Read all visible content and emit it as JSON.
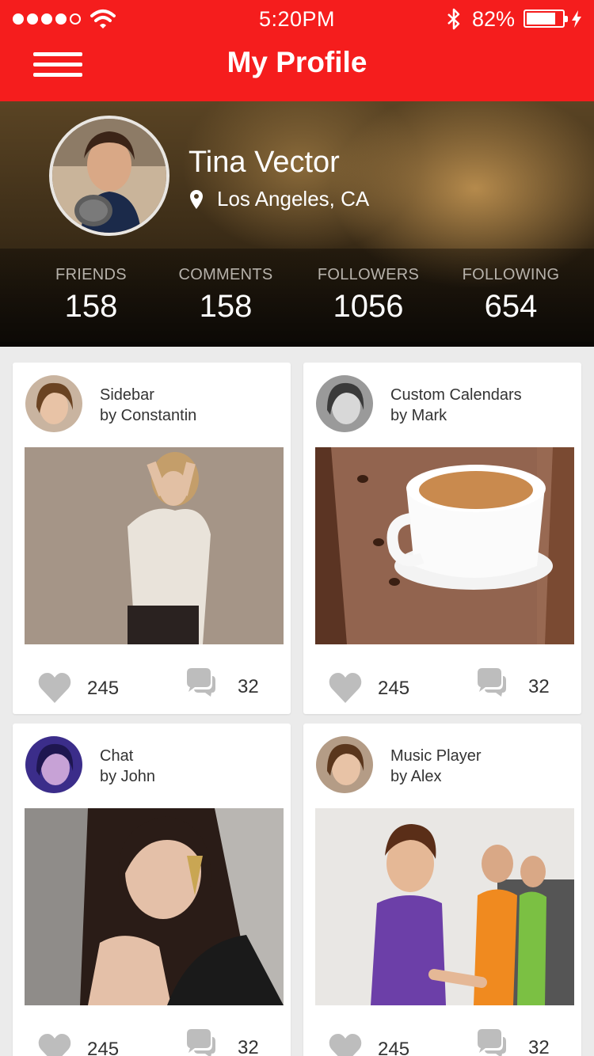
{
  "status_bar": {
    "time": "5:20PM",
    "battery": "82%",
    "battery_level": 0.82
  },
  "nav": {
    "title": "My Profile"
  },
  "profile": {
    "name": "Tina Vector",
    "location": "Los Angeles, CA",
    "stats": [
      {
        "label": "FRIENDS",
        "value": "158"
      },
      {
        "label": "COMMENTS",
        "value": "158"
      },
      {
        "label": "FOLLOWERS",
        "value": "1056"
      },
      {
        "label": "FOLLOWING",
        "value": "654"
      }
    ]
  },
  "posts": [
    {
      "title": "Sidebar",
      "author": "by Constantin",
      "likes": "245",
      "comments": "32"
    },
    {
      "title": "Custom Calendars",
      "author": "by Mark",
      "likes": "245",
      "comments": "32"
    },
    {
      "title": "Chat",
      "author": "by John",
      "likes": "245",
      "comments": "32"
    },
    {
      "title": "Music Player",
      "author": "by Alex",
      "likes": "245",
      "comments": "32"
    }
  ],
  "icons": {
    "menu": "hamburger-icon",
    "location": "map-pin-icon",
    "like": "heart-icon",
    "comment": "speech-bubbles-icon"
  },
  "colors": {
    "accent": "#f51d1d",
    "icon_gray": "#bdbdbd"
  }
}
